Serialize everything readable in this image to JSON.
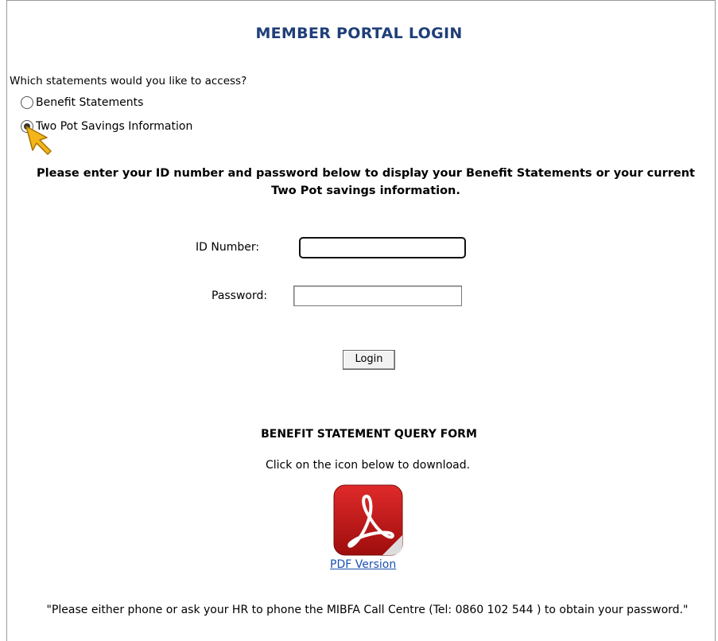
{
  "header": {
    "title": "MEMBER PORTAL LOGIN"
  },
  "statement_choice": {
    "question": "Which statements would you like to access?",
    "options": [
      {
        "label": "Benefit Statements",
        "selected": false
      },
      {
        "label": "Two Pot Savings Information",
        "selected": true
      }
    ]
  },
  "instructions": "Please enter your ID number and password below to display your Benefit Statements or your current Two Pot savings information.",
  "login_form": {
    "id_label": "ID Number:",
    "id_value": "",
    "password_label": "Password:",
    "password_value": "",
    "login_label": "Login"
  },
  "query_form": {
    "title": "BENEFIT STATEMENT QUERY FORM",
    "instruction": "Click on the icon below to download.",
    "pdf_icon": "acrobat-pdf-icon",
    "link_text": "PDF Version"
  },
  "footer_note": "\"Please either phone or ask your HR to phone the MIBFA Call Centre (Tel: 0860 102 544 ) to obtain your password.\"",
  "colors": {
    "title": "#1f3f79",
    "link": "#1a4fb3",
    "cursor_fill": "#f3b51b",
    "pdf_red": "#c21a1a"
  }
}
